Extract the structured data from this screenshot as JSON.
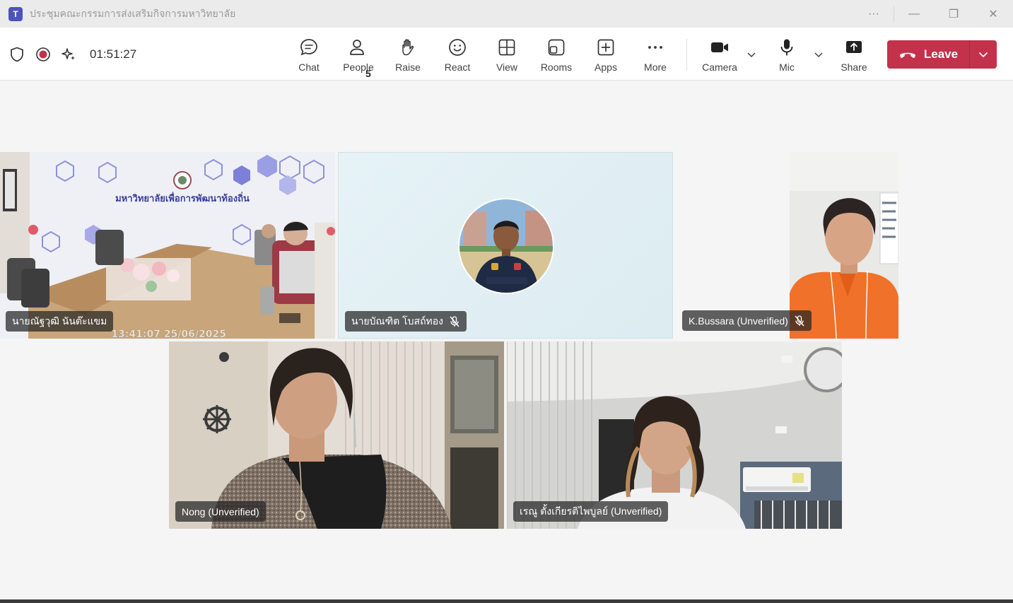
{
  "window": {
    "title": "ประชุมคณะกรรมการส่งเสริมกิจการมหาวิทยาลัย",
    "app_icon": "T",
    "controls": {
      "more": "···",
      "minimize": "—",
      "restore": "❐",
      "close": "✕"
    }
  },
  "toolbar": {
    "timer": "01:51:27",
    "status_icons": [
      "shield-icon",
      "recording-icon",
      "sparkle-icon"
    ],
    "items": [
      {
        "key": "chat",
        "label": "Chat",
        "icon": "chat-bubble-icon"
      },
      {
        "key": "people",
        "label": "People",
        "icon": "people-icon",
        "count": "5"
      },
      {
        "key": "raise",
        "label": "Raise",
        "icon": "raise-hand-icon"
      },
      {
        "key": "react",
        "label": "React",
        "icon": "smiley-icon"
      },
      {
        "key": "view",
        "label": "View",
        "icon": "grid-icon"
      },
      {
        "key": "rooms",
        "label": "Rooms",
        "icon": "rooms-icon"
      },
      {
        "key": "apps",
        "label": "Apps",
        "icon": "plus-square-icon"
      },
      {
        "key": "more",
        "label": "More",
        "icon": "ellipsis-icon"
      },
      {
        "key": "camera",
        "label": "Camera",
        "icon": "camera-icon"
      },
      {
        "key": "mic",
        "label": "Mic",
        "icon": "mic-icon"
      },
      {
        "key": "share",
        "label": "Share",
        "icon": "share-icon"
      }
    ],
    "leave_label": "Leave"
  },
  "participants": [
    {
      "name": "นายณัฐวุฒิ นันต๊ะแขม",
      "muted": false,
      "overlay_text": "13:41:07 25/06/2025",
      "banner_text": "มหาวิทยาลัยเพื่อการพัฒนาท้องถิ่น"
    },
    {
      "name": "นายบัณฑิต โบสถ์ทอง",
      "muted": true
    },
    {
      "name": "K.Bussara (Unverified)",
      "muted": true
    },
    {
      "name": "Nong (Unverified)",
      "muted": false
    },
    {
      "name": "เรณู ตั้งเกียรติไพบูลย์ (Unverified)",
      "muted": false
    }
  ],
  "colors": {
    "leave": "#c4314b",
    "brand": "#4b53bc",
    "record": "#c4314b"
  }
}
